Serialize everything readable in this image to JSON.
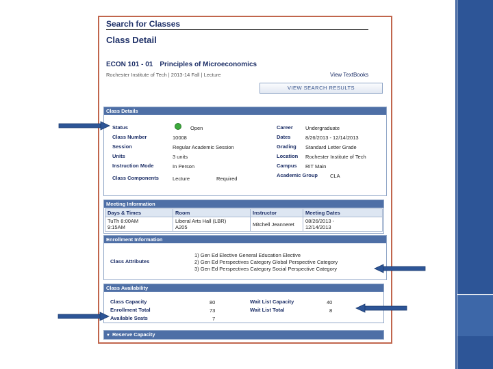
{
  "page": {
    "search_title": "Search for Classes",
    "detail_title": "Class Detail",
    "course_code": "ECON  101 - 01",
    "course_name": "Principles of Microeconomics",
    "course_sub": "Rochester Institute of Tech  |  2013-14 Fall  |  Lecture",
    "textbooks_link": "View TextBooks",
    "view_results_button": "VIEW SEARCH RESULTS"
  },
  "class_details": {
    "header": "Class Details",
    "status_label": "Status",
    "status_value": "Open",
    "class_number_label": "Class Number",
    "class_number_value": "10008",
    "session_label": "Session",
    "session_value": "Regular Academic Session",
    "units_label": "Units",
    "units_value": "3 units",
    "instruction_mode_label": "Instruction Mode",
    "instruction_mode_value": "In Person",
    "class_components_label": "Class Components",
    "class_components_value": "Lecture",
    "class_components_req": "Required",
    "career_label": "Career",
    "career_value": "Undergraduate",
    "dates_label": "Dates",
    "dates_value": "8/26/2013 - 12/14/2013",
    "grading_label": "Grading",
    "grading_value": "Standard Letter Grade",
    "location_label": "Location",
    "location_value": "Rochester Institute of Tech",
    "campus_label": "Campus",
    "campus_value": "RIT Main",
    "academic_group_label": "Academic Group",
    "academic_group_value": "CLA",
    "status_color": "#3daa3d"
  },
  "meeting_info": {
    "header": "Meeting Information",
    "columns": [
      "Days & Times",
      "Room",
      "Instructor",
      "Meeting Dates"
    ],
    "row": {
      "days_line1": "TuTh 8:00AM",
      "days_line2": "9:15AM",
      "room_line1": "Liberal Arts Hall (LBR)",
      "room_line2": "A205",
      "instructor": "Mitchell Jeanneret",
      "dates_line1": "08/26/2013 -",
      "dates_line2": "12/14/2013"
    }
  },
  "enrollment_info": {
    "header": "Enrollment Information",
    "class_attributes_label": "Class Attributes",
    "attributes": [
      "1) Gen Ed Elective  General Education Elective",
      "2) Gen Ed Perspectives Category  Global Perspective Category",
      "3) Gen Ed Perspectives Category  Social Perspective Category"
    ]
  },
  "availability": {
    "header": "Class Availability",
    "class_capacity_label": "Class Capacity",
    "class_capacity_value": "80",
    "enrollment_total_label": "Enrollment Total",
    "enrollment_total_value": "73",
    "available_seats_label": "Available Seats",
    "available_seats_value": "7",
    "wait_list_capacity_label": "Wait List Capacity",
    "wait_list_capacity_value": "40",
    "wait_list_total_label": "Wait List Total",
    "wait_list_total_value": "8"
  },
  "reserve": {
    "header": "Reserve Capacity",
    "expander_icon": "triangle-down-icon"
  },
  "colors": {
    "frame_border": "#c0654c",
    "header_bar": "#4e6fa6",
    "arrow": "#2d5597",
    "side_bar": "#2d5597"
  }
}
